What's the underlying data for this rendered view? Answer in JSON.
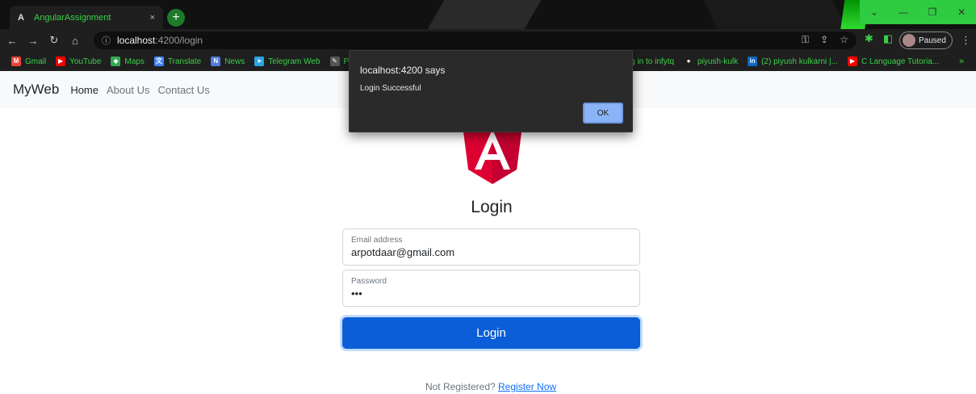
{
  "browser": {
    "tab_title": "AngularAssignment",
    "tab_favicon": "A",
    "tab_close": "×",
    "new_tab": "+",
    "url_host": "localhost",
    "url_path": ":4200/login",
    "profile_label": "Paused",
    "bookmarks": [
      {
        "label": "Gmail",
        "icon": "M",
        "color": "#ea4335"
      },
      {
        "label": "YouTube",
        "icon": "▶",
        "color": "#ff0000"
      },
      {
        "label": "Maps",
        "icon": "◆",
        "color": "#34a853"
      },
      {
        "label": "Translate",
        "icon": "文",
        "color": "#4285f4"
      },
      {
        "label": "News",
        "icon": "N",
        "color": "#4f7bd9"
      },
      {
        "label": "Telegram Web",
        "icon": "➤",
        "color": "#2ca5e0"
      },
      {
        "label": "P",
        "icon": "✎",
        "color": "#555555"
      }
    ],
    "bookmarks_right": [
      {
        "label": "Log in to infytq",
        "icon": "",
        "color": "#1f1f1f"
      },
      {
        "label": "piyush-kulk",
        "icon": "●",
        "color": "#1f1f1f"
      },
      {
        "label": "(2) piyush kulkarni |...",
        "icon": "in",
        "color": "#0a66c2"
      },
      {
        "label": "C Language Tutoria...",
        "icon": "▶",
        "color": "#ff0000"
      }
    ],
    "more_bookmarks": "»"
  },
  "app": {
    "brand": "MyWeb",
    "nav": [
      "Home",
      "About Us",
      "Contact Us"
    ]
  },
  "login": {
    "title": "Login",
    "email_label": "Email address",
    "email_value": "arpotdaar@gmail.com",
    "password_label": "Password",
    "password_value": "•••",
    "button_label": "Login",
    "register_prompt": "Not Registered?",
    "register_link": "Register Now"
  },
  "dialog": {
    "title": "localhost:4200 says",
    "message": "Login Successful",
    "ok_label": "OK"
  },
  "colors": {
    "primary": "#0b5ed7",
    "angular_red": "#dd0031",
    "angular_dark_red": "#c3002f",
    "theme_green": "#3bd14a"
  }
}
